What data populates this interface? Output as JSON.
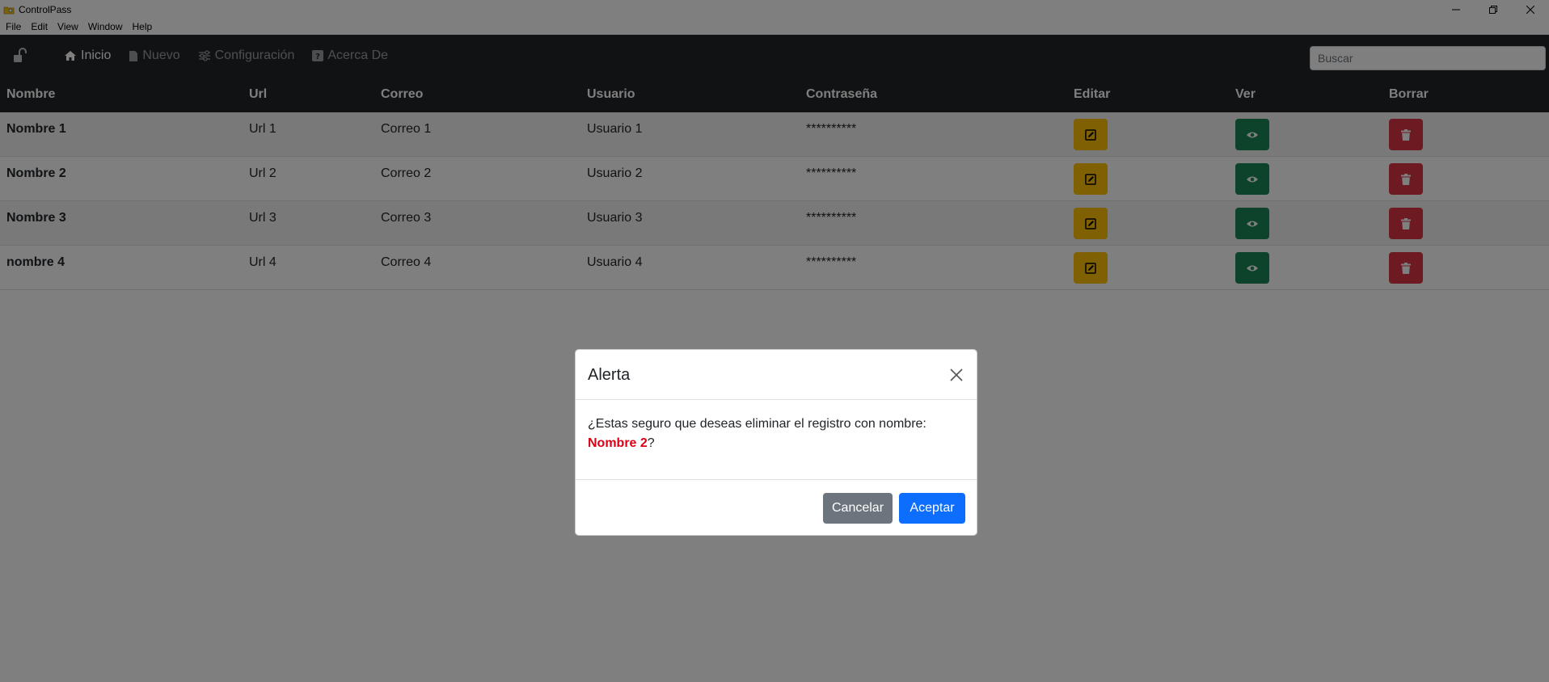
{
  "window": {
    "title": "ControlPass"
  },
  "menubar": [
    "File",
    "Edit",
    "View",
    "Window",
    "Help"
  ],
  "navbar": {
    "links": [
      {
        "label": "Inicio",
        "icon": "home-icon",
        "active": true
      },
      {
        "label": "Nuevo",
        "icon": "file-icon",
        "active": false
      },
      {
        "label": "Configuración",
        "icon": "sliders-icon",
        "active": false
      },
      {
        "label": "Acerca De",
        "icon": "question-icon",
        "active": false
      }
    ],
    "search_placeholder": "Buscar"
  },
  "table": {
    "headers": [
      "Nombre",
      "Url",
      "Correo",
      "Usuario",
      "Contraseña",
      "Editar",
      "Ver",
      "Borrar"
    ],
    "rows": [
      {
        "nombre": "Nombre 1",
        "url": "Url 1",
        "correo": "Correo 1",
        "usuario": "Usuario 1",
        "password": "**********"
      },
      {
        "nombre": "Nombre 2",
        "url": "Url 2",
        "correo": "Correo 2",
        "usuario": "Usuario 2",
        "password": "**********"
      },
      {
        "nombre": "Nombre 3",
        "url": "Url 3",
        "correo": "Correo 3",
        "usuario": "Usuario 3",
        "password": "**********"
      },
      {
        "nombre": "nombre 4",
        "url": "Url 4",
        "correo": "Correo 4",
        "usuario": "Usuario 4",
        "password": "**********"
      }
    ]
  },
  "modal": {
    "title": "Alerta",
    "message": "¿Estas seguro que deseas eliminar el registro con nombre:",
    "highlight": "Nombre 2",
    "suffix": "?",
    "cancel_label": "Cancelar",
    "accept_label": "Aceptar"
  },
  "colors": {
    "navbar": "#212529",
    "warning": "#ffc107",
    "success": "#198754",
    "danger": "#dc3545",
    "primary": "#0d6efd",
    "secondary": "#6c757d",
    "highlight": "#dc0014"
  }
}
